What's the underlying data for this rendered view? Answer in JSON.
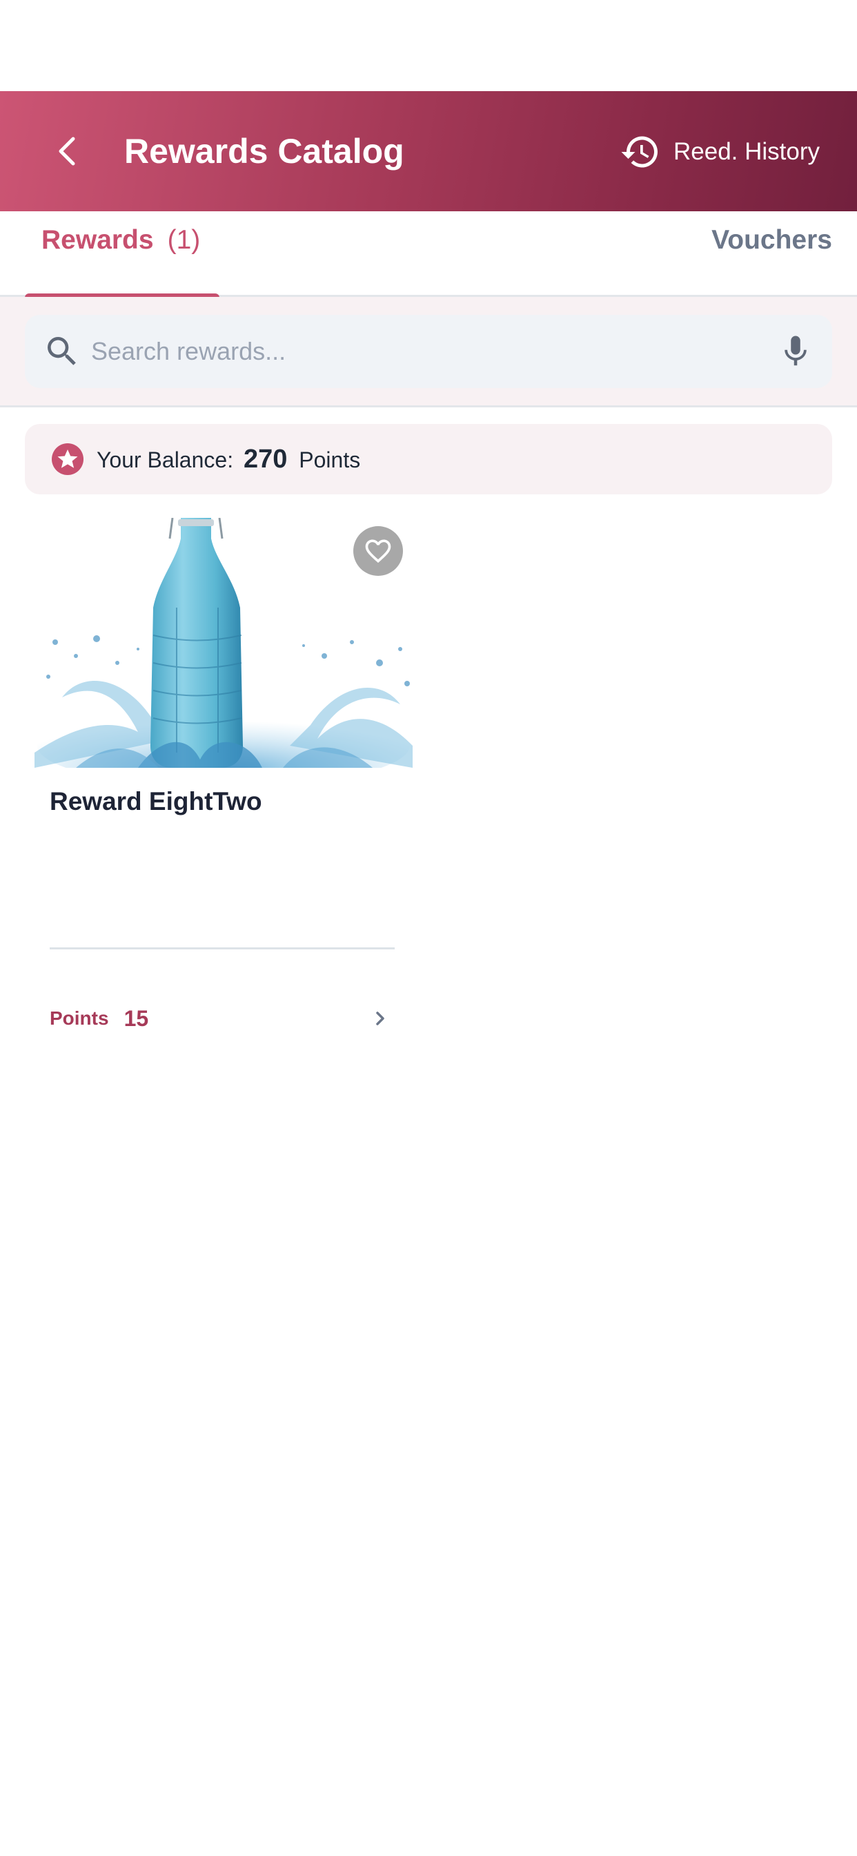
{
  "header": {
    "title": "Rewards Catalog",
    "history_label": "Reed. History",
    "back_icon": "back-arrow-icon",
    "history_icon": "history-clock-icon"
  },
  "tabs": [
    {
      "label": "Rewards",
      "count": "(1)",
      "active": true
    },
    {
      "label": "Vouchers",
      "active": false
    }
  ],
  "search": {
    "placeholder": "Search rewards...",
    "value": "",
    "search_icon": "search-icon",
    "mic_icon": "mic-icon"
  },
  "balance": {
    "prefix": "Your Balance:",
    "value": "270",
    "unit": "Points",
    "icon": "star-badge-icon"
  },
  "rewards": [
    {
      "title": "Reward EightTwo",
      "points_label": "Points",
      "points_value": "15",
      "image": "water-bottle-splash",
      "favorite": false
    }
  ],
  "colors": {
    "accent": "#c7506f",
    "header_gradient_start": "#cc5574",
    "header_gradient_end": "#72203d",
    "points_text": "#a63a58",
    "inactive_tab": "#6b7689"
  }
}
